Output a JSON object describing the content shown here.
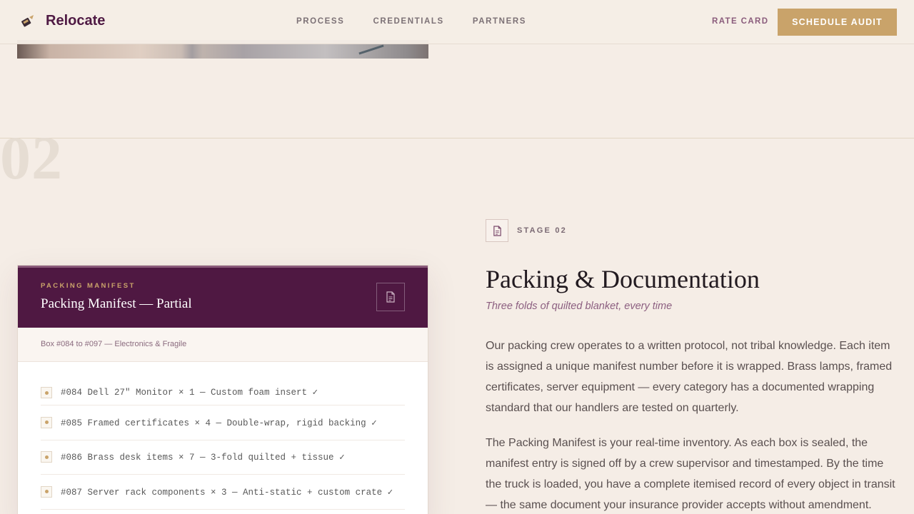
{
  "header": {
    "brand_name": "Relocate",
    "nav": [
      "PROCESS",
      "CREDENTIALS",
      "PARTNERS"
    ],
    "rate_card": "RATE CARD",
    "cta": "SCHEDULE AUDIT"
  },
  "section": {
    "number": "02",
    "stage_label": "STAGE 02",
    "title": "Packing & Documentation",
    "tagline": "Three folds of quilted blanket, every time",
    "paragraphs": [
      "Our packing crew operates to a written protocol, not tribal knowledge. Each item is assigned a unique manifest number before it is wrapped. Brass lamps, framed certificates, server equipment — every category has a documented wrapping standard that our handlers are tested on quarterly.",
      "The Packing Manifest is your real-time inventory. As each box is sealed, the manifest entry is signed off by a crew supervisor and timestamped. By the time the truck is loaded, you have a complete itemised record of every object in transit — the same document your insurance provider accepts without amendment."
    ]
  },
  "manifest": {
    "eyebrow": "PACKING MANIFEST",
    "title": "Packing Manifest — Partial",
    "subtitle": "Box #084 to #097 — Electronics & Fragile",
    "items": [
      "#084 Dell 27\" Monitor × 1 — Custom foam insert ✓",
      "#085 Framed certificates × 4 — Double-wrap, rigid backing ✓",
      "#086 Brass desk items × 7 — 3-fold quilted + tissue ✓",
      "#087 Server rack components × 3 — Anti-static + custom crate ✓"
    ]
  },
  "colors": {
    "accent_gold": "#c9a36a",
    "brand_plum": "#4f1842",
    "background": "#f5ede6"
  }
}
